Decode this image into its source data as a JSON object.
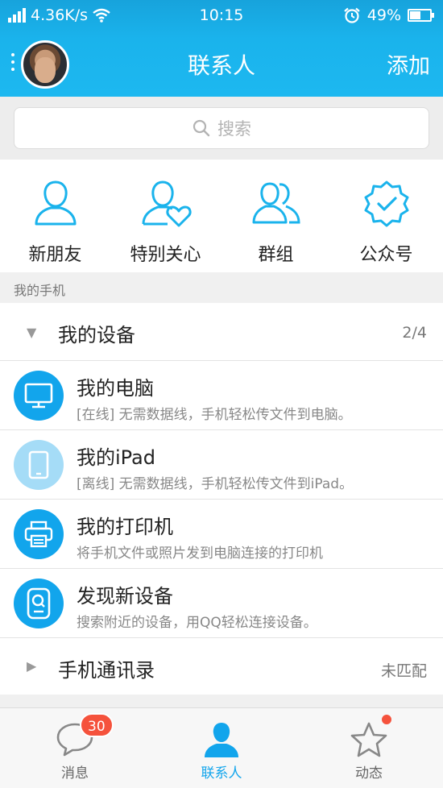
{
  "status_bar": {
    "net_speed": "4.36K/s",
    "time": "10:15",
    "battery": "49%",
    "battery_level": 0.49,
    "icons": [
      "signal-icon",
      "wifi-icon",
      "alarm-icon",
      "battery-icon"
    ]
  },
  "header": {
    "title": "联系人",
    "add_label": "添加"
  },
  "search": {
    "placeholder": "搜索"
  },
  "quick_actions": [
    {
      "label": "新朋友",
      "icon": "person-icon"
    },
    {
      "label": "特别关心",
      "icon": "person-heart-icon"
    },
    {
      "label": "群组",
      "icon": "group-icon"
    },
    {
      "label": "公众号",
      "icon": "verified-badge-icon"
    }
  ],
  "section_my_phone": {
    "title": "我的手机"
  },
  "my_devices": {
    "title": "我的设备",
    "count": "2/4",
    "items": [
      {
        "name": "我的电脑",
        "desc": "[在线] 无需数据线，手机轻松传文件到电脑。",
        "icon": "monitor-icon"
      },
      {
        "name": "我的iPad",
        "desc": "[离线] 无需数据线，手机轻松传文件到iPad。",
        "icon": "tablet-icon"
      },
      {
        "name": "我的打印机",
        "desc": "将手机文件或照片发到电脑连接的打印机",
        "icon": "printer-icon"
      },
      {
        "name": "发现新设备",
        "desc": "搜索附近的设备，用QQ轻松连接设备。",
        "icon": "device-search-icon"
      }
    ]
  },
  "phone_contacts": {
    "title": "手机通讯录",
    "status": "未匹配"
  },
  "tabs": [
    {
      "label": "消息",
      "badge": "30",
      "icon": "chat-bubble-icon"
    },
    {
      "label": "联系人",
      "icon": "contacts-icon",
      "active": true
    },
    {
      "label": "动态",
      "icon": "star-icon"
    }
  ],
  "colors": {
    "accent": "#1ab3ec",
    "badge": "#f5523c"
  }
}
